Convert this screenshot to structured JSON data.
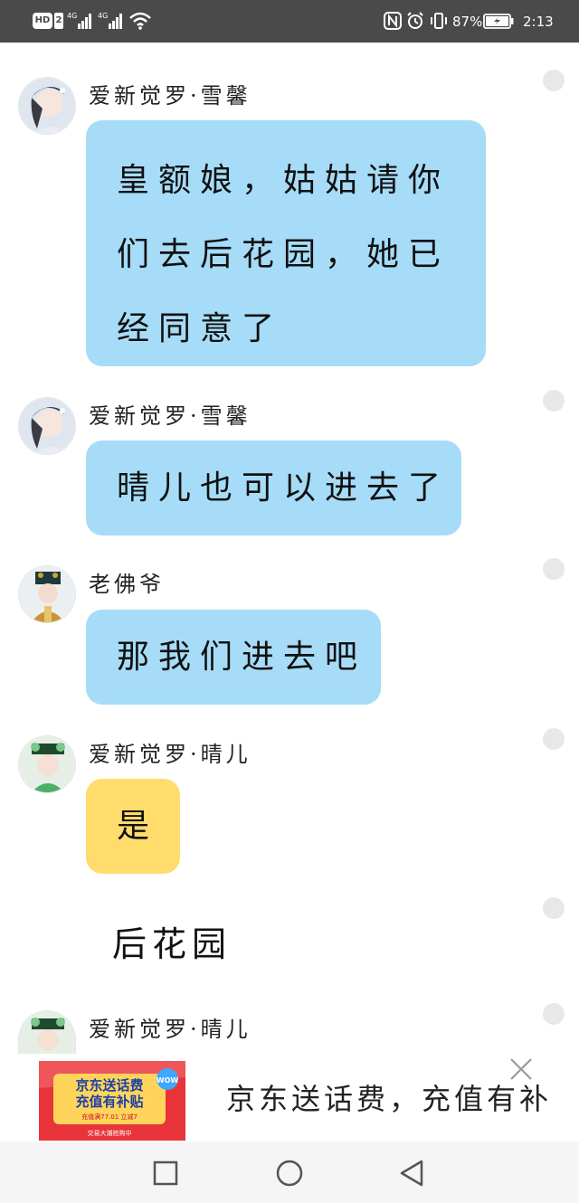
{
  "status_bar": {
    "hd_label": "HD",
    "hd_sim": "2",
    "signal1_label": "4G",
    "signal2_label": "4G",
    "battery_percent": "87%",
    "time": "2:13",
    "icons": [
      "signal-icon",
      "wifi-icon",
      "nfc-icon",
      "alarm-icon",
      "vibrate-icon",
      "battery-icon"
    ]
  },
  "messages": [
    {
      "sender": "爱新觉罗·雪馨",
      "lines": [
        "皇额娘，姑姑请你",
        "们去后花园，她已",
        "经同意了"
      ],
      "color": "#a6dcf7",
      "avatar": "avatar-xuexin"
    },
    {
      "sender": "爱新觉罗·雪馨",
      "lines": [
        "晴儿也可以进去了"
      ],
      "color": "#a6dcf7",
      "avatar": "avatar-xuexin"
    },
    {
      "sender": "老佛爷",
      "lines": [
        "那我们进去吧"
      ],
      "color": "#a6dcf7",
      "avatar": "avatar-laofoye"
    },
    {
      "sender": "爱新觉罗·晴儿",
      "lines": [
        "是"
      ],
      "color": "#ffdc6b",
      "avatar": "avatar-qinger"
    },
    {
      "scene": "后花园"
    },
    {
      "sender": "爱新觉罗·晴儿",
      "avatar": "avatar-qinger"
    }
  ],
  "ad": {
    "image_text_1": "京东送话费",
    "image_text_2": "充值有补贴",
    "image_badge": "WOW",
    "image_sub": "充值满77.01 立减7",
    "image_footer": "交易大潮抢购中",
    "text": "京东送话费，充值有补",
    "close_icon": "close-icon"
  },
  "nav": {
    "icons": [
      "recent-apps-icon",
      "home-icon",
      "back-icon"
    ]
  },
  "colors": {
    "status_bar": "#4a4a4a",
    "bubble_blue": "#a6dcf7",
    "bubble_yellow": "#ffdc6b",
    "nav_bar": "#f5f5f5"
  }
}
